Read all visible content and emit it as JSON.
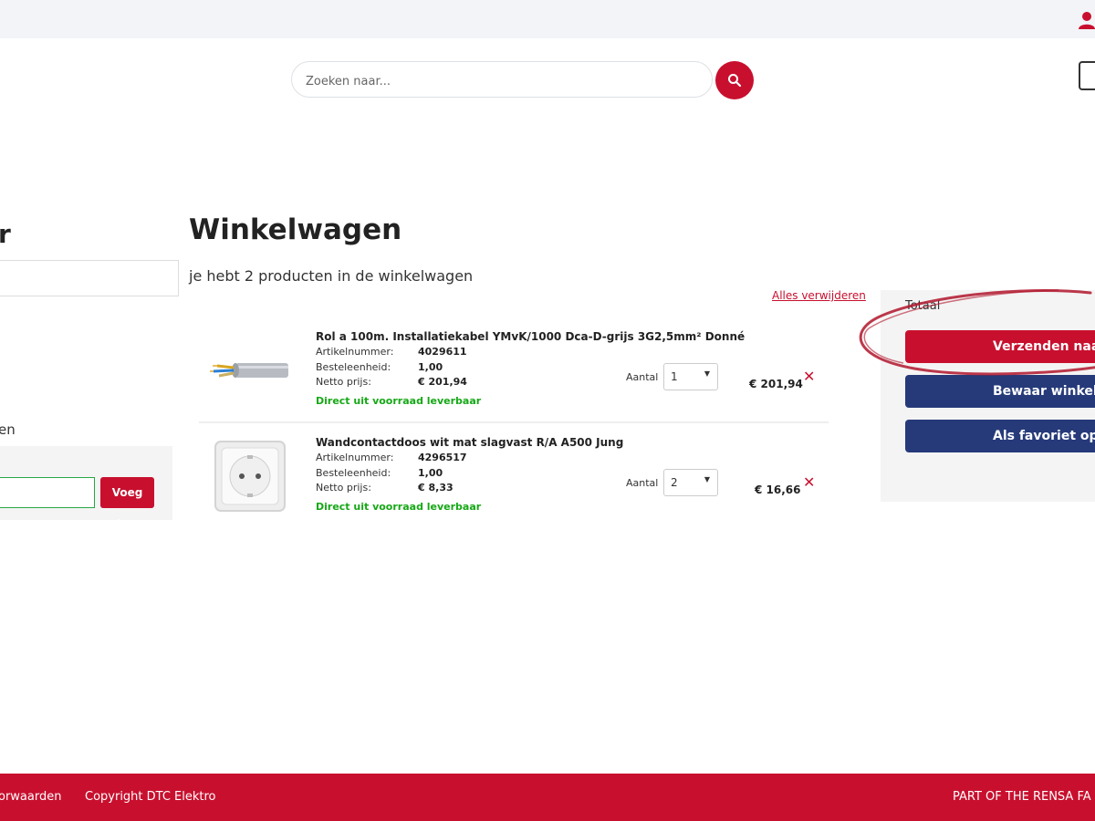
{
  "search": {
    "placeholder": "Zoeken naar..."
  },
  "sidebar": {
    "heading_fragment": "r",
    "label_fragment": "en",
    "add_button": "Voeg toe"
  },
  "cart": {
    "title": "Winkelwagen",
    "subtitle": "je hebt 2 producten in de winkelwagen",
    "remove_all": "Alles verwijderen",
    "quantity_label": "Aantal",
    "field_labels": {
      "article": "Artikelnummer:",
      "unit": "Besteleenheid:",
      "net": "Netto prijs:"
    },
    "items": [
      {
        "name": "Rol a 100m. Installatiekabel YMvK/1000 Dca-D-grijs 3G2,5mm² Donné",
        "article_number": "4029611",
        "order_unit": "1,00",
        "net_price": "€ 201,94",
        "availability": "Direct uit voorraad leverbaar",
        "quantity": "1",
        "line_total": "€ 201,94",
        "image": "cable-roll-image"
      },
      {
        "name": "Wandcontactdoos wit mat slagvast R/A A500 Jung",
        "article_number": "4296517",
        "order_unit": "1,00",
        "net_price": "€ 8,33",
        "availability": "Direct uit voorraad leverbaar",
        "quantity": "2",
        "line_total": "€ 16,66",
        "image": "wall-socket-image"
      }
    ]
  },
  "summary": {
    "total_label": "Totaal",
    "send_button": "Verzenden naar",
    "save_button": "Bewaar winkelwa",
    "favorite_button": "Als favoriet opsl"
  },
  "footer": {
    "terms": "orwaarden",
    "copyright": "Copyright DTC Elektro",
    "family": "PART OF THE RENSA FA"
  },
  "colors": {
    "brand_red": "#c8102e",
    "navy": "#263a7a",
    "available_green": "#16a816"
  }
}
